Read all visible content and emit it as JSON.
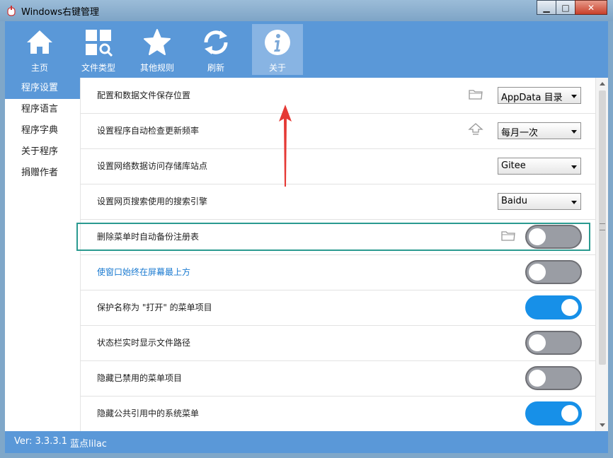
{
  "window": {
    "title": "Windows右键管理",
    "controls": {
      "minimize": "▁",
      "maximize": "□",
      "close": "✕"
    }
  },
  "toolbar": {
    "items": [
      {
        "label": "主页",
        "icon": "home-icon"
      },
      {
        "label": "文件类型",
        "icon": "file-types-icon"
      },
      {
        "label": "其他规则",
        "icon": "star-icon"
      },
      {
        "label": "刷新",
        "icon": "refresh-icon"
      },
      {
        "label": "关于",
        "icon": "info-icon",
        "active": true
      }
    ]
  },
  "sidebar": {
    "items": [
      {
        "label": "程序设置",
        "active": true
      },
      {
        "label": "程序语言"
      },
      {
        "label": "程序字典"
      },
      {
        "label": "关于程序"
      },
      {
        "label": "捐赠作者"
      }
    ]
  },
  "settings": {
    "rows": [
      {
        "label": "配置和数据文件保存位置",
        "control": "select",
        "value": "AppData 目录",
        "icon": "folder-icon"
      },
      {
        "label": "设置程序自动检查更新频率",
        "control": "select",
        "value": "每月一次",
        "icon": "lightbulb-icon"
      },
      {
        "label": "设置网络数据访问存储库站点",
        "control": "select",
        "value": "Gitee"
      },
      {
        "label": "设置网页搜索使用的搜索引擎",
        "control": "select",
        "value": "Baidu"
      },
      {
        "label": "删除菜单时自动备份注册表",
        "control": "toggle",
        "on": false,
        "icon": "folder-icon",
        "highlighted": true
      },
      {
        "label": "使窗口始终在屏幕最上方",
        "control": "toggle",
        "on": false,
        "link": true
      },
      {
        "label": "保护名称为 \"打开\" 的菜单项目",
        "control": "toggle",
        "on": true
      },
      {
        "label": "状态栏实时显示文件路径",
        "control": "toggle",
        "on": false
      },
      {
        "label": "隐藏已禁用的菜单项目",
        "control": "toggle",
        "on": false
      },
      {
        "label": "隐藏公共引用中的系统菜单",
        "control": "toggle",
        "on": true
      }
    ]
  },
  "statusbar": {
    "version": "Ver: 3.3.3.1",
    "author": "蓝点lilac"
  },
  "colors": {
    "accent": "#5a98d8",
    "toggle_on": "#1790e8",
    "toggle_off": "#9a9da4",
    "highlight_border": "#2a9a90",
    "annotation_arrow": "#e53935"
  }
}
